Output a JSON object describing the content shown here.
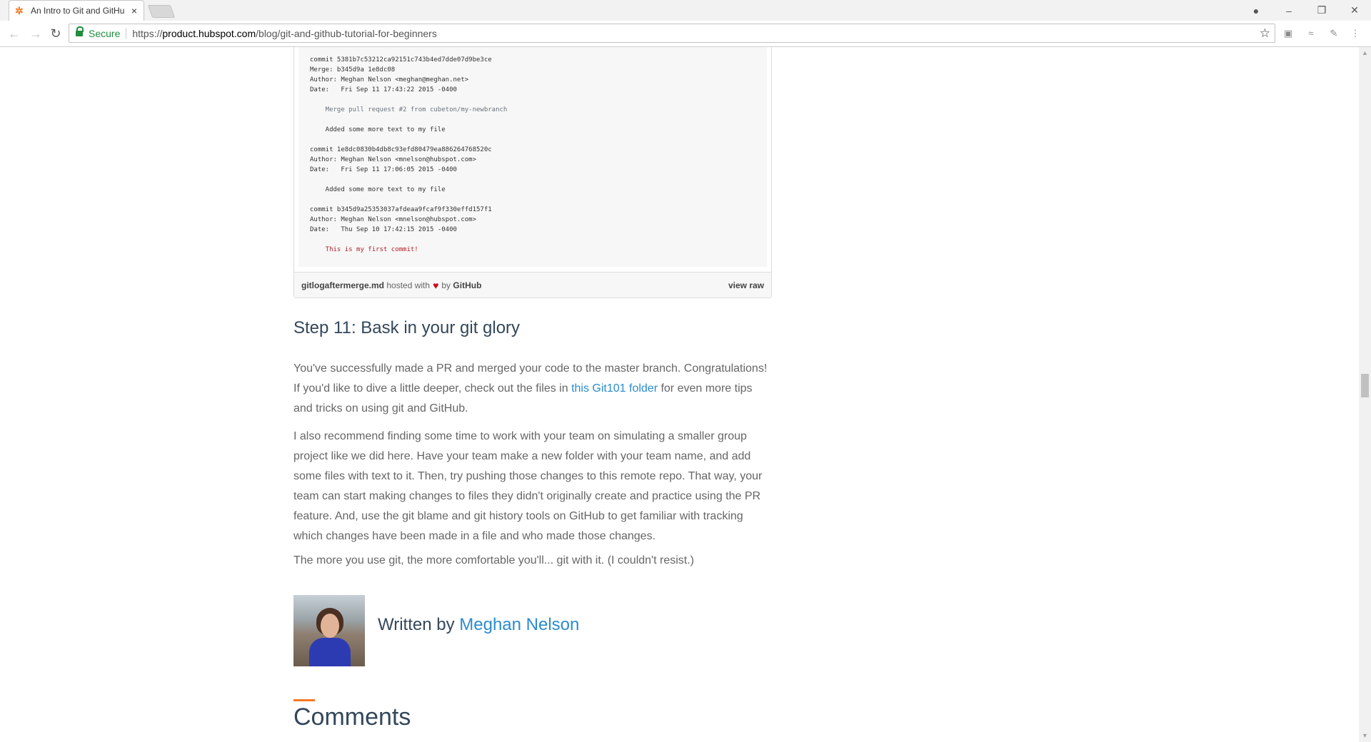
{
  "browser": {
    "tab": {
      "title": "An Intro to Git and GitHu",
      "close": "×",
      "favicon": "hubspot-sprocket"
    },
    "window_controls": {
      "account": "●",
      "minimize": "–",
      "restore": "❐",
      "close": "✕"
    },
    "nav": {
      "back": "←",
      "forward": "→",
      "reload": "↻"
    },
    "omnibox": {
      "secure_label": "Secure",
      "scheme": "https://",
      "host": "product.hubspot.com",
      "path": "/blog/git-and-github-tutorial-for-beginners",
      "bookmark_star": "☆"
    },
    "extensions": [
      "▣",
      "≈",
      "✎",
      "⋮"
    ]
  },
  "scrollbar": {
    "up": "▲",
    "down": "▼"
  },
  "gist": {
    "commits": [
      {
        "hash_line": "commit 5381b7c53212ca92151c743b4ed7dde07d9be3ce",
        "merge_line": "Merge: b345d9a 1e8dc08",
        "author_line": "Author: Meghan Nelson <meghan@meghan.net>",
        "date_line": "Date:   Fri Sep 11 17:43:22 2015 -0400",
        "message_1": "    Merge pull request #2 from cubeton/my-newbranch",
        "message_2": "    Added some more text to my file"
      },
      {
        "hash_line": "commit 1e8dc0830b4db8c93efd80479ea886264768520c",
        "author_line": "Author: Meghan Nelson <mnelson@hubspot.com>",
        "date_line": "Date:   Fri Sep 11 17:06:05 2015 -0400",
        "message_1": "    Added some more text to my file"
      },
      {
        "hash_line": "commit b345d9a25353037afdeaa9fcaf9f330effd157f1",
        "author_line": "Author: Meghan Nelson <mnelson@hubspot.com>",
        "date_line": "Date:   Thu Sep 10 17:42:15 2015 -0400",
        "message_1": "    This is my first commit!"
      }
    ],
    "filename": "gitlogaftermerge.md",
    "hosted_with": "hosted with",
    "heart": "♥",
    "by": "by",
    "github": "GitHub",
    "view_raw": "view raw"
  },
  "article": {
    "step_heading": "Step 11: Bask in your git glory",
    "para1_a": "You've successfully made a PR and merged your code to the master branch. Congratulations! If you'd like to dive a little deeper, check out the files in ",
    "para1_link": "this Git101 folder",
    "para1_b": " for even more tips and tricks on using git and GitHub.",
    "para2": "I also recommend finding some time to work with your team on simulating a smaller group project like we did here. Have your team make a new folder with your team name, and add some files with text to it. Then, try pushing those changes to this remote repo. That way, your team can start making changes to files they didn't originally create and practice using the PR feature. And, use the git blame and git history tools on GitHub to get familiar with tracking which changes have been made in a file and who made those changes.",
    "para3": "The more you use git, the more comfortable you'll... git with it. (I couldn't resist.)",
    "written_by": "Written by ",
    "author_name": "Meghan Nelson",
    "comments_heading": "Comments"
  },
  "colors": {
    "link": "#2b8ccf",
    "heading": "#33475b",
    "body_text": "#666666",
    "accent": "#f57722",
    "secure_green": "#1e8e3e"
  }
}
